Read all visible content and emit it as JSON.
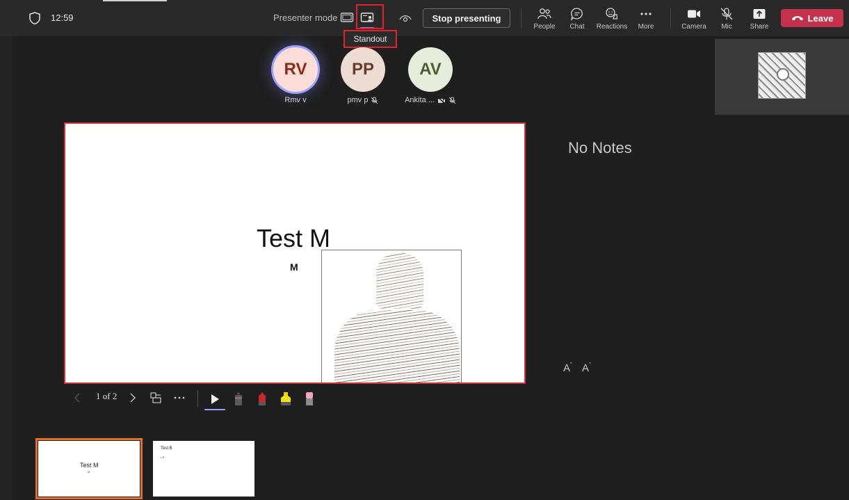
{
  "header": {
    "time": "12:59",
    "presenter_mode_label": "Presenter mode",
    "tooltip": "Standout",
    "stop_presenting": "Stop presenting",
    "leave": "Leave",
    "toolbar": [
      {
        "id": "people",
        "label": "People"
      },
      {
        "id": "chat",
        "label": "Chat"
      },
      {
        "id": "reactions",
        "label": "Reactions"
      },
      {
        "id": "more",
        "label": "More"
      },
      {
        "id": "camera",
        "label": "Camera"
      },
      {
        "id": "mic",
        "label": "Mic"
      },
      {
        "id": "share",
        "label": "Share"
      }
    ]
  },
  "participants": [
    {
      "initials": "RV",
      "name": "Rmv v",
      "bg": "#fcdcd6",
      "fg": "#8a2c1c"
    },
    {
      "initials": "PP",
      "name": "pmv p",
      "bg": "#eddcd2",
      "fg": "#6b3c2a"
    },
    {
      "initials": "AV",
      "name": "Ankita ...",
      "bg": "#e6eedb",
      "fg": "#4b5d34"
    }
  ],
  "slide": {
    "title": "Test M",
    "subtitle": "M"
  },
  "notes": {
    "empty_text": "No Notes",
    "increase_font": "A",
    "decrease_font": "A"
  },
  "navigation": {
    "page_count": "1 of 2"
  },
  "thumbnails": [
    {
      "title": "Test M",
      "sub": "M"
    },
    {
      "title": "Test B",
      "sub": "• B"
    }
  ],
  "colors": {
    "accent": "#7f85f5",
    "leave": "#c4314b",
    "highlight": "#e5212c",
    "selected_thumb": "#e0702a"
  }
}
